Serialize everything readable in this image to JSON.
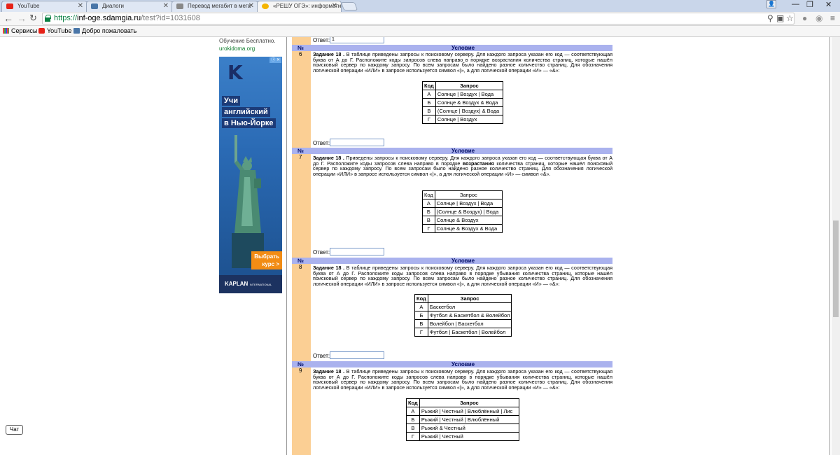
{
  "browser": {
    "tabs": [
      {
        "label": "YouTube",
        "color": "#e62117"
      },
      {
        "label": "Диалоги",
        "color": "#4a76a8"
      },
      {
        "label": "Перевод мегабит в мега",
        "color": "#888888"
      },
      {
        "label": "«РЕШУ ОГЭ»: информати",
        "color": "#f4b400"
      }
    ],
    "url": {
      "proto": "https://",
      "host": "inf-oge.sdamgia.ru",
      "path": "/test?id=1031608"
    },
    "bookmarks": [
      {
        "label": "Сервисы",
        "icon": "apps-icon"
      },
      {
        "label": "YouTube",
        "icon": "youtube-icon"
      },
      {
        "label": "Добро пожаловать",
        "icon": "vk-icon"
      }
    ]
  },
  "sidebar": {
    "promo_text": "Обучение Бесплатно.",
    "promo_link": "urokidoma.org",
    "ad": {
      "words": [
        "Учи",
        "английский",
        "в Нью-Йорке"
      ],
      "cta": [
        "Выбрать",
        "курс >"
      ],
      "brand": "KAPLAN",
      "brand_sub": "INTERNATIONAL ENGLISH"
    },
    "chat_label": "Чат"
  },
  "labels": {
    "answer": "Ответ:",
    "no": "№",
    "condition": "Условие",
    "code": "Код",
    "query": "Запрос"
  },
  "answer_first_value": "1",
  "tasks": [
    {
      "num": "6",
      "title": "Задание 18 .",
      "text": "В таблице приведены запросы к поисковому серверу. Для каждого запроса указан его код — соответствующая буква от А до Г. Расположите коды запросов слева направо в порядке возрастания количества страниц, которые нашёл поисковый сервер по каждому запросу. По всем запросам было найдено разное количество страниц. Для обозначения логической операции «ИЛИ» в запросе используется символ «|», а для логической операции «И» — «&»:",
      "rows": [
        {
          "k": "А",
          "q": "Солнце | Воздух | Вода"
        },
        {
          "k": "Б",
          "q": "Солнце & Воздух & Вода"
        },
        {
          "k": "В",
          "q": "(Солнце | Воздух) & Вода"
        },
        {
          "k": "Г",
          "q": "Солнце | Воздух"
        }
      ]
    },
    {
      "num": "7",
      "title": "Задание 18 .",
      "text_before": "Приведены запросы к поисковому серверу. Для каждого запроса указан его код — соответствующая буква от А до Г. Расположите коды запросов слева направо в порядке ",
      "text_bold": "возрастания",
      "text_after": " количества страниц, которые нашёл поисковый сервер по каждому запросу. По всем запросам было найдено разное количество страниц. Для обозначения логической операции «ИЛИ» в запросе используется символ «|», а для логической операции «И» — символ «&».",
      "rows": [
        {
          "k": "А",
          "q": "Солнце | Воздух | Вода"
        },
        {
          "k": "Б",
          "q": "(Солнце & Воздух) | Вода"
        },
        {
          "k": "В",
          "q": "Солнце & Воздух"
        },
        {
          "k": "Г",
          "q": "Солнце & Воздух & Вода"
        }
      ]
    },
    {
      "num": "8",
      "title": "Задание 18 .",
      "text": "В таблице приведены запросы к поисковому серверу. Для каждого запроса указан его код — соответствующая буква от А до Г. Расположите коды запросов слева направо в порядке убывания количества страниц, которые нашёл поисковый сервер по каждому запросу. По всем запросам было найдено разное количество страниц. Для обозначения логической операции «ИЛИ» в запросе используется символ «|», а для логической операции «И» — «&»:",
      "rows": [
        {
          "k": "А",
          "q": "Баскетбол"
        },
        {
          "k": "Б",
          "q": "Футбол & Баскетбол & Волейбол"
        },
        {
          "k": "В",
          "q": "Волейбол | Баскетбол"
        },
        {
          "k": "Г",
          "q": "Футбол | Баскетбол | Волейбол"
        }
      ]
    },
    {
      "num": "9",
      "title": "Задание 18 .",
      "text": "В таблице приведены запросы к поисковому серверу. Для каждого запроса указан его код — соответствующая буква от А до Г. Расположите коды запросов слева направо в порядке убывания количества страниц, которые нашёл поисковый сервер по каждому запросу. По всем запросам было найдено разное количество страниц. Для обозначения логической операции «ИЛИ» в запросе используется символ «|», а для логической операции «И» — «&»:",
      "rows": [
        {
          "k": "А",
          "q": "Рыжий | Честный | Влюблённый | Лис"
        },
        {
          "k": "Б",
          "q": "Рыжий | Честный | Влюблённый"
        },
        {
          "k": "В",
          "q": "Рыжий & Честный"
        },
        {
          "k": "Г",
          "q": "Рыжий | Честный"
        }
      ]
    }
  ]
}
